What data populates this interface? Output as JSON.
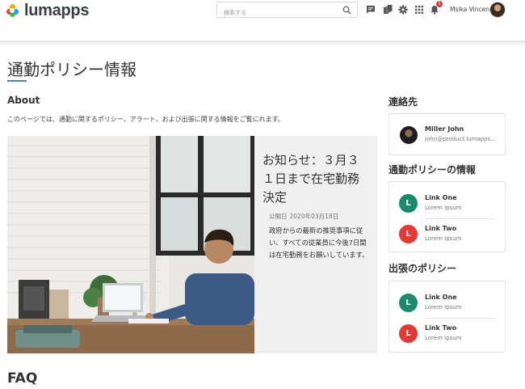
{
  "header": {
    "logo_text": "lumapps",
    "search_placeholder": "検索する",
    "notification_count": "1",
    "user_name": "Msika Vincent"
  },
  "page": {
    "title": "通勤ポリシー情報",
    "about_heading": "About",
    "about_text": "このページでは、通勤に関するポリシー、アラート、および出張に関する情報をご覧にれます。",
    "faq_heading": "FAQ"
  },
  "news": {
    "title": "お知らせ：３月３１日まで在宅勤務決定",
    "date_label": "公開日",
    "date": "2020年03月18日",
    "body": "政府からの最新の推奨事項に従い、すべての従業員に今後7日間は在宅勤務をお願いしています。"
  },
  "sidebar": {
    "contact_heading": "連絡先",
    "contact": {
      "name": "Miller John",
      "email": "john@product.lumapps..."
    },
    "policy_heading": "通勤ポリシーの情報",
    "policy_links": [
      {
        "letter": "L",
        "title": "Link One",
        "subtitle": "Lorem Ipsum",
        "color": "#1a8a6e"
      },
      {
        "letter": "L",
        "title": "Link Two",
        "subtitle": "Lorem Ipsum",
        "color": "#e53935"
      }
    ],
    "travel_heading": "出張のポリシー",
    "travel_links": [
      {
        "letter": "L",
        "title": "Link One",
        "subtitle": "Lorem Ipsum",
        "color": "#1a8a6e"
      },
      {
        "letter": "L",
        "title": "Link Two",
        "subtitle": "Lorem Ipsum",
        "color": "#e53935"
      }
    ]
  },
  "icons": {
    "search": "search-icon",
    "chat": "chat-icon",
    "content": "content-icon",
    "settings": "gear-icon",
    "apps": "apps-grid-icon",
    "notifications": "bell-icon"
  }
}
